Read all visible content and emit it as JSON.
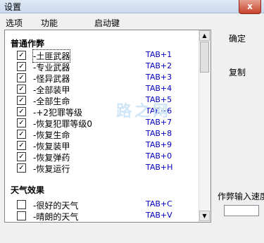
{
  "window": {
    "title": "设置",
    "close_glyph": "x"
  },
  "menu": [
    {
      "label": "选项"
    },
    {
      "label": "功能"
    },
    {
      "label": "启动键"
    }
  ],
  "list": {
    "sections": [
      {
        "title": "普通作弊",
        "items": [
          {
            "label": "-土匪武器",
            "hotkey": "TAB+1",
            "checked": true
          },
          {
            "label": "-专业武器",
            "hotkey": "TAB+2",
            "checked": true
          },
          {
            "label": "-怪异武器",
            "hotkey": "TAB+3",
            "checked": true
          },
          {
            "label": "-全部装甲",
            "hotkey": "TAB+4",
            "checked": true
          },
          {
            "label": "-全部生命",
            "hotkey": "TAB+5",
            "checked": true
          },
          {
            "label": "-+2犯罪等级",
            "hotkey": "TAB+6",
            "checked": true
          },
          {
            "label": "-恢复犯罪等级0",
            "hotkey": "TAB+7",
            "checked": true
          },
          {
            "label": "-恢复生命",
            "hotkey": "TAB+8",
            "checked": true
          },
          {
            "label": "-恢复装甲",
            "hotkey": "TAB+9",
            "checked": true
          },
          {
            "label": "-恢复弹药",
            "hotkey": "TAB+0",
            "checked": true
          },
          {
            "label": "-恢复运行",
            "hotkey": "TAB+H",
            "checked": true
          }
        ]
      },
      {
        "title": "天气效果",
        "items": [
          {
            "label": "-很好的天气",
            "hotkey": "TAB+C",
            "checked": false
          },
          {
            "label": "-晴朗的天气",
            "hotkey": "TAB+V",
            "checked": false
          }
        ]
      }
    ],
    "check_glyph": "✓"
  },
  "buttons": {
    "confirm": "确定",
    "copy": "复制"
  },
  "speed": {
    "label": "作弊输入速度"
  },
  "watermark": "路之网",
  "scroll": {
    "up_glyph": "▲",
    "down_glyph": "▼"
  }
}
